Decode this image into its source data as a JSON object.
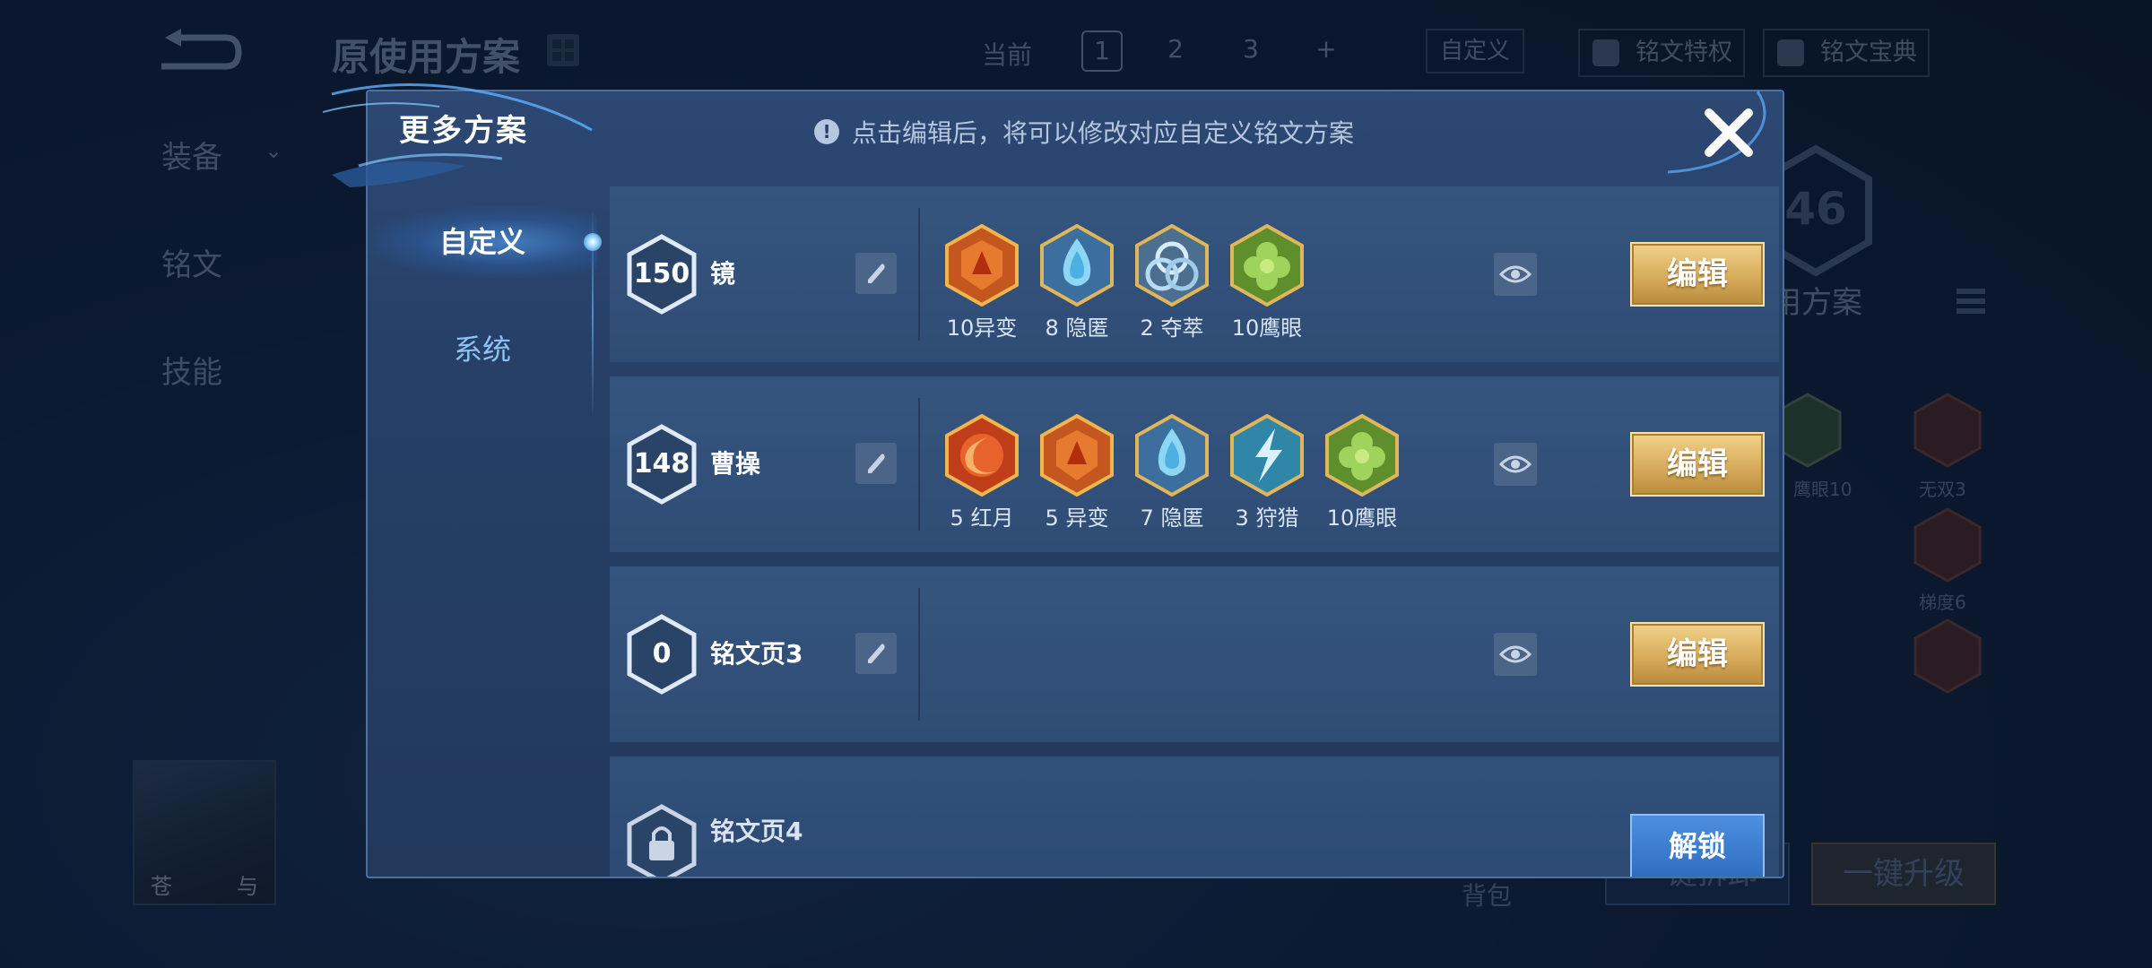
{
  "background": {
    "title": "原使用方案",
    "current_label": "当前",
    "pages": [
      "1",
      "2",
      "3",
      "+"
    ],
    "custom_button": "自定义",
    "privilege_button": "铭文特权",
    "treasury_button": "铭文宝典",
    "side_menu": [
      "装备",
      "铭文",
      "技能"
    ],
    "level_badge": "46",
    "scheme_label": "用方案",
    "rune_labels": [
      "鹰眼10",
      "无双3",
      "梯度6"
    ],
    "avatar_name": [
      "苍",
      "与"
    ],
    "bag_label": "背包",
    "assemble_button": "一键拆卸",
    "upgrade_button": "一键升级"
  },
  "modal": {
    "title": "更多方案",
    "hint": "点击编辑后，将可以修改对应自定义铭文方案",
    "tabs": [
      "自定义",
      "系统"
    ],
    "schemes": [
      {
        "level": "150",
        "name": "镜",
        "edit_label": "编辑",
        "runes": [
          {
            "label": "10异变",
            "icon": "red-shield-rune",
            "color": "#d9642a"
          },
          {
            "label": "8 隐匿",
            "icon": "blue-drop-rune",
            "color": "#5fb4e6"
          },
          {
            "label": "2 夺萃",
            "icon": "blue-knot-rune",
            "color": "#8fb8d8"
          },
          {
            "label": "10鹰眼",
            "icon": "green-clover-rune",
            "color": "#86b84a"
          }
        ]
      },
      {
        "level": "148",
        "name": "曹操",
        "edit_label": "编辑",
        "runes": [
          {
            "label": "5 红月",
            "icon": "red-moon-rune",
            "color": "#d24a26"
          },
          {
            "label": "5 异变",
            "icon": "red-shield-rune",
            "color": "#d9642a"
          },
          {
            "label": "7 隐匿",
            "icon": "blue-drop-rune",
            "color": "#5fb4e6"
          },
          {
            "label": "3 狩猎",
            "icon": "blue-lightning-rune",
            "color": "#4fb4d6"
          },
          {
            "label": "10鹰眼",
            "icon": "green-clover-rune",
            "color": "#86b84a"
          }
        ]
      },
      {
        "level": "0",
        "name": "铭文页3",
        "edit_label": "编辑",
        "runes": []
      },
      {
        "name": "铭文页4",
        "locked": true,
        "unlock_label": "解锁"
      }
    ]
  }
}
